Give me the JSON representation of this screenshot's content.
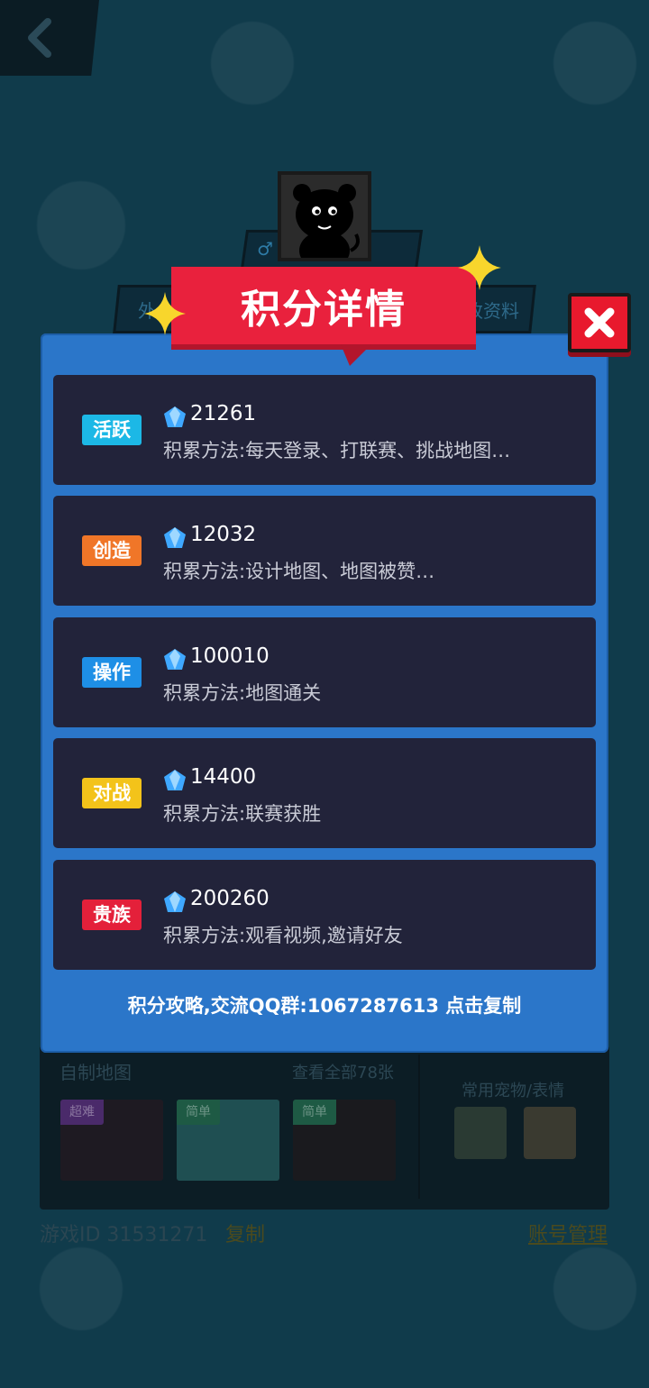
{
  "background": {
    "side_tab_left": "外",
    "side_tab_right": "改资料",
    "gender_symbol": "♂",
    "custom_maps_label": "自制地图",
    "view_all_label": "查看全部78张",
    "common_pets_label": "常用宠物/表情",
    "map_thumbs": [
      {
        "tag": "超难",
        "tag_color": "#7b2fbf"
      },
      {
        "tag": "简单",
        "tag_color": "#2e9a6a"
      },
      {
        "tag": "简单",
        "tag_color": "#2e9a6a"
      }
    ],
    "game_id": "游戏ID 31531271",
    "copy_label": "复制",
    "account_label": "账号管理"
  },
  "dialog": {
    "title": "积分详情",
    "close_icon": "close-x-icon",
    "items": [
      {
        "badge": "活跃",
        "badge_color": "#1cb8e6",
        "score": "21261",
        "method": "积累方法:每天登录、打联赛、挑战地图…"
      },
      {
        "badge": "创造",
        "badge_color": "#f07628",
        "score": "12032",
        "method": "积累方法:设计地图、地图被赞…"
      },
      {
        "badge": "操作",
        "badge_color": "#1e8fe6",
        "score": "100010",
        "method": "积累方法:地图通关"
      },
      {
        "badge": "对战",
        "badge_color": "#f3c31a",
        "score": "14400",
        "method": "积累方法:联赛获胜"
      },
      {
        "badge": "贵族",
        "badge_color": "#e4203a",
        "score": "200260",
        "method": "积累方法:观看视频,邀请好友"
      }
    ],
    "footer": "积分攻略,交流QQ群:1067287613 点击复制"
  },
  "colors": {
    "dialog_bg": "#2b76c9",
    "card_bg": "#22233a",
    "banner": "#e9213d",
    "star": "#f8d62c"
  }
}
